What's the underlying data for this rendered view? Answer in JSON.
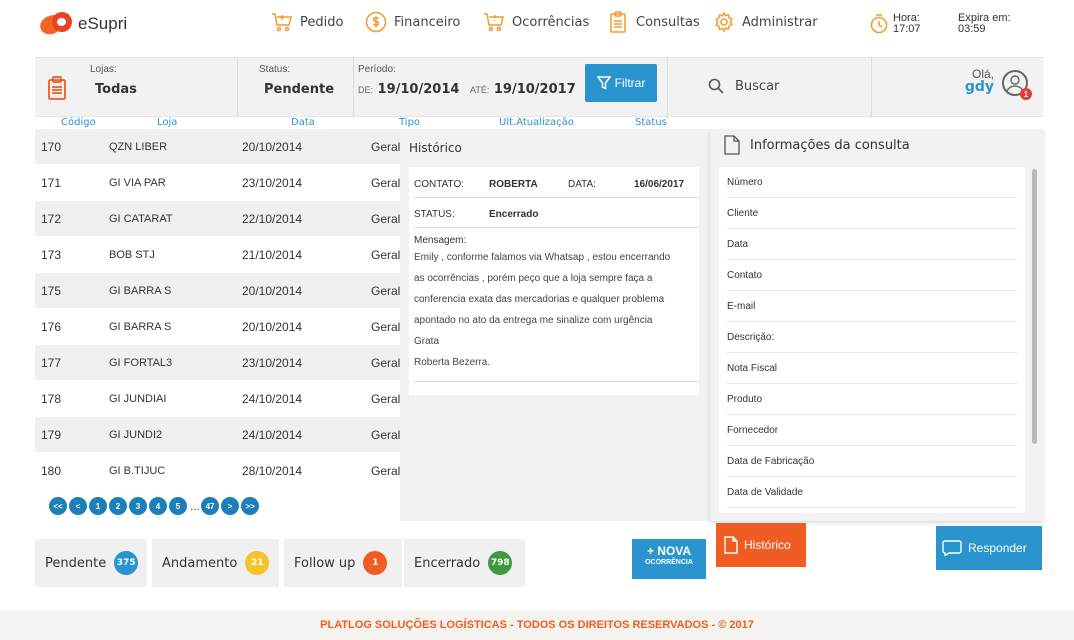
{
  "brand": {
    "name": "eSupri",
    "logo_icon": "esupri-logo"
  },
  "nav": [
    {
      "label": "Pedido",
      "icon": "cart-icon"
    },
    {
      "label": "Financeiro",
      "icon": "dollar-icon"
    },
    {
      "label": "Ocorrências",
      "icon": "cart-alert-icon"
    },
    {
      "label": "Consultas",
      "icon": "clipboard-icon"
    },
    {
      "label": "Administrar",
      "icon": "gear-icon"
    }
  ],
  "clock": {
    "hora_label": "Hora:",
    "hora_value": "17:07",
    "expira_label": "Expira em:",
    "expira_value": "03:59"
  },
  "filters": {
    "lojas_label": "Lojas:",
    "lojas_value": "Todas",
    "status_label": "Status:",
    "status_value": "Pendente",
    "periodo_label": "Período:",
    "de_label": "DE:",
    "de_value": "19/10/2014",
    "ate_label": "ATÉ:",
    "ate_value": "19/10/2017",
    "filter_button": "Filtrar",
    "search_placeholder": "Buscar"
  },
  "user": {
    "greeting": "Olá,",
    "name": "gdy",
    "notifications": "1"
  },
  "table": {
    "headers": [
      "Código",
      "Loja",
      "Data",
      "Tipo",
      "Ult.Atualização",
      "Status"
    ],
    "rows": [
      [
        "170",
        "QZN LIBER",
        "20/10/2014",
        "Geral"
      ],
      [
        "171",
        "GI VIA PAR",
        "23/10/2014",
        "Geral"
      ],
      [
        "172",
        "GI CATARAT",
        "22/10/2014",
        "Geral"
      ],
      [
        "173",
        "BOB STJ",
        "21/10/2014",
        "Geral"
      ],
      [
        "175",
        "GI BARRA S",
        "20/10/2014",
        "Geral"
      ],
      [
        "176",
        "GI BARRA S",
        "20/10/2014",
        "Geral"
      ],
      [
        "177",
        "GI FORTAL3",
        "23/10/2014",
        "Geral"
      ],
      [
        "178",
        "GI JUNDIAI",
        "24/10/2014",
        "Geral"
      ],
      [
        "179",
        "GI JUNDI2",
        "24/10/2014",
        "Geral"
      ],
      [
        "180",
        "GI B.TIJUC",
        "28/10/2014",
        "Geral"
      ]
    ]
  },
  "pagination": [
    "<<",
    "<",
    "1",
    "2",
    "3",
    "4",
    "5",
    "...",
    "47",
    ">",
    ">>"
  ],
  "historico": {
    "title": "Histórico",
    "contato_label": "CONTATO:",
    "contato_value": "ROBERTA",
    "data_label": "DATA:",
    "data_value": "16/06/2017",
    "status_label": "STATUS:",
    "status_value": "Encerrado",
    "mensagem_label": "Mensagem:",
    "mensagem_lines": [
      "Emily , conforme falamos via Whatsap , estou encerrando",
      "as ocorrências , porém peço que a loja sempre faça a",
      "conferencia exata das mercadorias e qualquer problema",
      "apontado no ato da entrega me sinalize com urgência",
      "Grata",
      "Roberta Bezerra."
    ]
  },
  "info": {
    "title": "Informações da consulta",
    "fields": [
      "Número",
      "Cliente",
      "Data",
      "Contato",
      "E-mail",
      "Descrição:",
      "Nota Fiscal",
      "Produto",
      "Fornecedor",
      "Data de Fabricação",
      "Data de Validade"
    ]
  },
  "status_counts": [
    {
      "label": "Pendente",
      "count": "375",
      "color": "#2a94cf"
    },
    {
      "label": "Andamento",
      "count": "21",
      "color": "#f5c42c"
    },
    {
      "label": "Follow up",
      "count": "1",
      "color": "#f05c22"
    },
    {
      "label": "Encerrado",
      "count": "798",
      "color": "#3f9a3f"
    }
  ],
  "actions": {
    "nova_big": "+ NOVA",
    "nova_small": "OCORRÊNCIA",
    "historico": "Histórico",
    "responder": "Responder"
  },
  "footer": "PLATLOG SOLUÇÕES LOGÍSTICAS - TODOS OS DIREITOS RESERVADOS - © 2017",
  "colors": {
    "accent": "#2a94cf",
    "orange": "#f05c22",
    "icon_orange": "#f39a2b"
  }
}
